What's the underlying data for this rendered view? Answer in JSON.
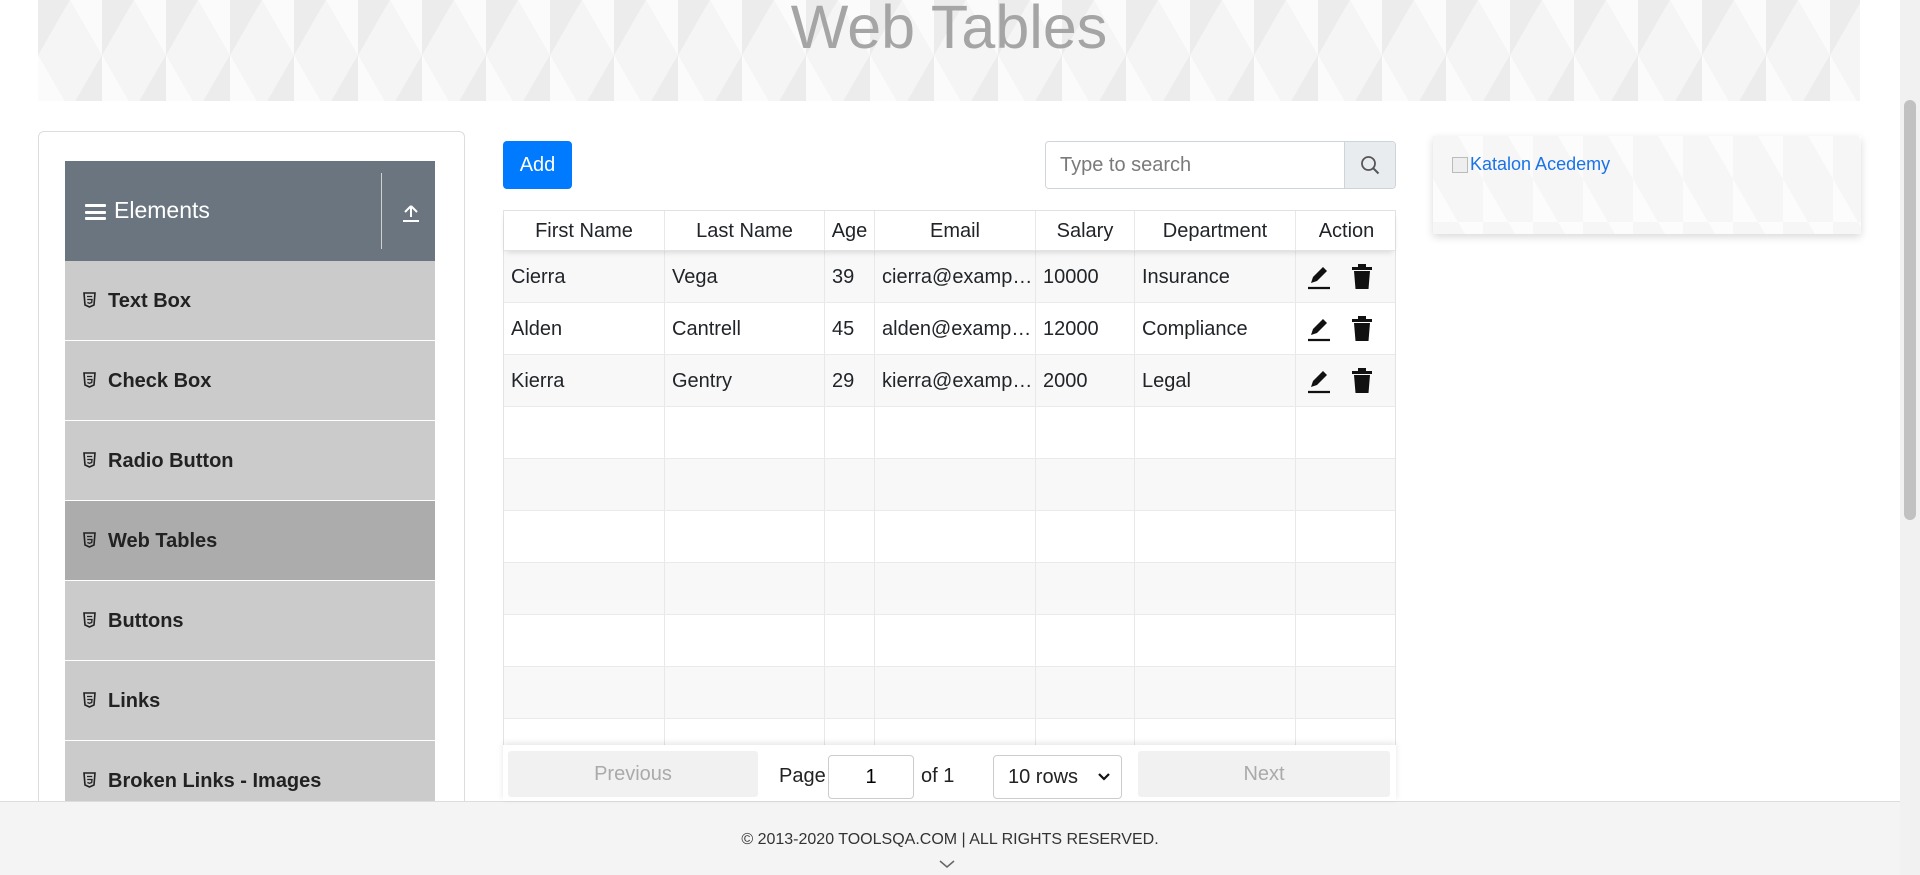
{
  "page": {
    "title": "Web Tables"
  },
  "sidebar": {
    "group_title": "Elements",
    "items": [
      {
        "label": "Text Box",
        "active": false
      },
      {
        "label": "Check Box",
        "active": false
      },
      {
        "label": "Radio Button",
        "active": false
      },
      {
        "label": "Web Tables",
        "active": true
      },
      {
        "label": "Buttons",
        "active": false
      },
      {
        "label": "Links",
        "active": false
      },
      {
        "label": "Broken Links - Images",
        "active": false
      }
    ]
  },
  "toolbar": {
    "add_label": "Add",
    "search_placeholder": "Type to search",
    "search_value": ""
  },
  "table": {
    "columns": [
      "First Name",
      "Last Name",
      "Age",
      "Email",
      "Salary",
      "Department",
      "Action"
    ],
    "rows": [
      [
        "Cierra",
        "Vega",
        "39",
        "cierra@example.com",
        "10000",
        "Insurance"
      ],
      [
        "Alden",
        "Cantrell",
        "45",
        "alden@example.com",
        "12000",
        "Compliance"
      ],
      [
        "Kierra",
        "Gentry",
        "29",
        "kierra@example.com",
        "2000",
        "Legal"
      ]
    ],
    "empty_rows": 7
  },
  "pagination": {
    "previous_label": "Previous",
    "next_label": "Next",
    "page_label": "Page",
    "page_value": "1",
    "of_label": "of 1",
    "rows_selected": "10 rows"
  },
  "ad": {
    "alt_text": "Katalon Acedemy"
  },
  "footer": {
    "copyright": "© 2013-2020 TOOLSQA.COM | ALL RIGHTS RESERVED."
  },
  "icons": {
    "menu": "hamburger-icon",
    "collapse": "upload-arrow-icon",
    "item": "html5-icon",
    "search": "magnifier-icon",
    "edit": "pencil-icon",
    "delete": "trash-icon",
    "footer": "chevron-down-icon"
  },
  "colors": {
    "primary": "#007bff",
    "sidebar_header": "#6b7580",
    "menu_item": "#cbcbcb",
    "menu_item_active": "#acacac"
  }
}
